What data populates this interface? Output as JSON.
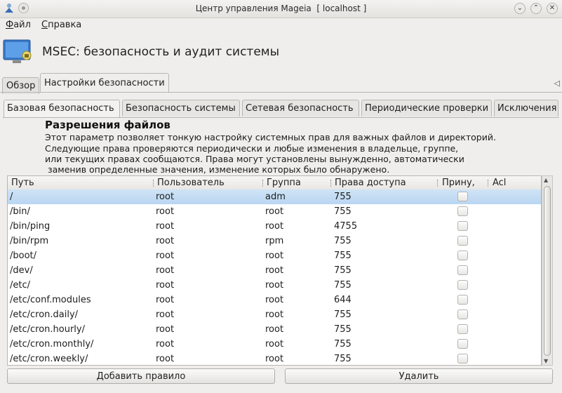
{
  "window": {
    "title": "Центр управления Mageia  [ localhost ]"
  },
  "menu": {
    "file": "Файл",
    "help": "Справка"
  },
  "header": {
    "title": "MSEC: безопасность и аудит системы"
  },
  "tabs": [
    {
      "label": "Обзор"
    },
    {
      "label": "Настройки безопасности"
    }
  ],
  "subtabs": [
    {
      "label": "Базовая безопасность"
    },
    {
      "label": "Безопасность системы"
    },
    {
      "label": "Сетевая безопасность"
    },
    {
      "label": "Периодические проверки"
    },
    {
      "label": "Исключения"
    }
  ],
  "section": {
    "title": "Разрешения файлов",
    "lines": [
      "Этот параметр позволяет тонкую настройку системных прав для важных файлов и директорий.",
      "Следующие права проверяются периодически и любые изменения в владельце, группе,",
      "или текущих правах сообщаются. Права могут установлены вынужденно, автоматически",
      " заменив определенные значения, изменение которых было обнаружено."
    ]
  },
  "table": {
    "headers": [
      "Путь",
      "Пользователь",
      "Группа",
      "Права доступа",
      "Прину,",
      "Acl"
    ],
    "rows": [
      {
        "path": "/",
        "user": "root",
        "group": "adm",
        "perm": "755"
      },
      {
        "path": "/bin/",
        "user": "root",
        "group": "root",
        "perm": "755"
      },
      {
        "path": "/bin/ping",
        "user": "root",
        "group": "root",
        "perm": "4755"
      },
      {
        "path": "/bin/rpm",
        "user": "root",
        "group": "rpm",
        "perm": "755"
      },
      {
        "path": "/boot/",
        "user": "root",
        "group": "root",
        "perm": "755"
      },
      {
        "path": "/dev/",
        "user": "root",
        "group": "root",
        "perm": "755"
      },
      {
        "path": "/etc/",
        "user": "root",
        "group": "root",
        "perm": "755"
      },
      {
        "path": "/etc/conf.modules",
        "user": "root",
        "group": "root",
        "perm": "644"
      },
      {
        "path": "/etc/cron.daily/",
        "user": "root",
        "group": "root",
        "perm": "755"
      },
      {
        "path": "/etc/cron.hourly/",
        "user": "root",
        "group": "root",
        "perm": "755"
      },
      {
        "path": "/etc/cron.monthly/",
        "user": "root",
        "group": "root",
        "perm": "755"
      },
      {
        "path": "/etc/cron.weekly/",
        "user": "root",
        "group": "root",
        "perm": "755"
      }
    ]
  },
  "buttons": {
    "add": "Добавить правило",
    "delete": "Удалить"
  }
}
